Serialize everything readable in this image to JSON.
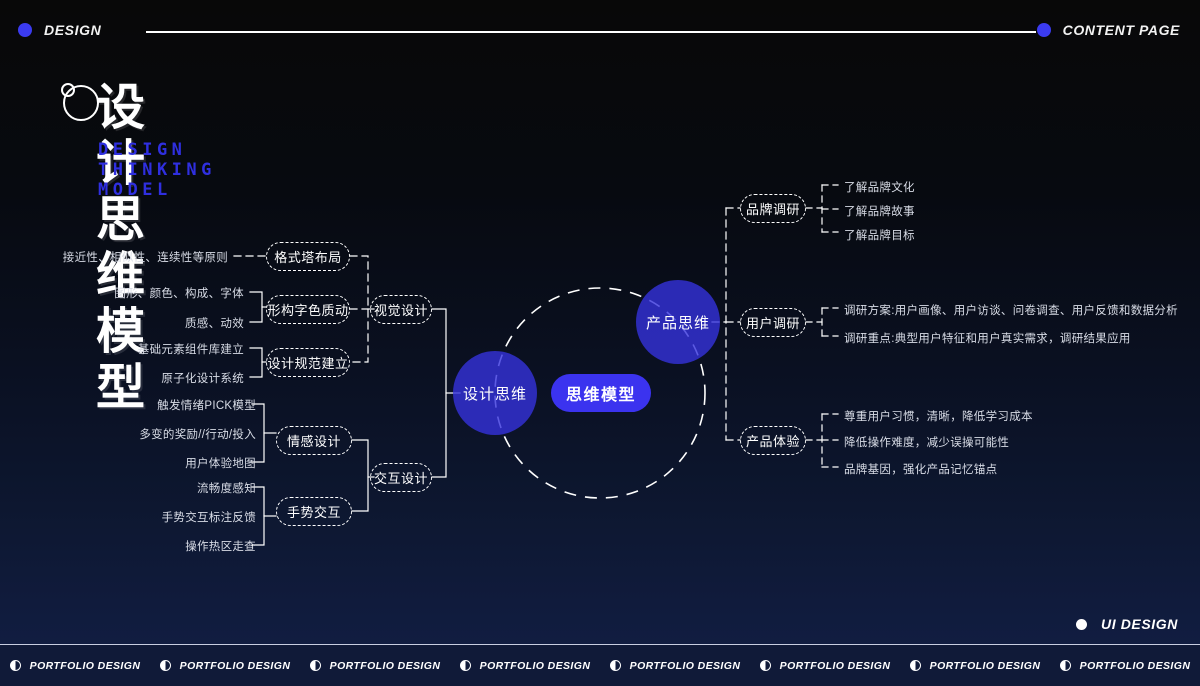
{
  "header": {
    "left_label": "DESIGN",
    "right_label": "CONTENT PAGE",
    "left_dot_icon": "blue-dot-icon",
    "right_dot_icon": "blue-dot-icon",
    "accent_color": "#3b3bf0"
  },
  "title": {
    "cn": "设计思维模型",
    "en": "DESIGN THINKING MODEL",
    "en_color": "#2f2fe0",
    "decor_icon": "ring-with-small-circle-icon"
  },
  "center": {
    "core_label": "思维模型",
    "core_color": "#3b33ef",
    "left_circle_label": "设计思维",
    "right_circle_label": "产品思维",
    "circle_color": "#3532dc",
    "ring_style": "dashed"
  },
  "left_branch": {
    "nodes": [
      {
        "label": "视觉设计",
        "children": [
          {
            "label": "格式塔布局",
            "leaves": [
              "接近性、相似性、连续性等原则"
            ]
          },
          {
            "label": "形构字色质动",
            "leaves": [
              "图形、颜色、构成、字体",
              "质感、动效"
            ]
          },
          {
            "label": "设计规范建立",
            "leaves": [
              "基础元素组件库建立",
              "原子化设计系统"
            ]
          }
        ]
      },
      {
        "label": "交互设计",
        "children": [
          {
            "label": "情感设计",
            "leaves": [
              "触发情绪PICK模型",
              "多变的奖励//行动/投入",
              "用户体验地图"
            ]
          },
          {
            "label": "手势交互",
            "leaves": [
              "流畅度感知",
              "手势交互标注反馈",
              "操作热区走查"
            ]
          }
        ]
      }
    ]
  },
  "right_branch": {
    "nodes": [
      {
        "label": "品牌调研",
        "leaves": [
          "了解品牌文化",
          "了解品牌故事",
          "了解品牌目标"
        ]
      },
      {
        "label": "用户调研",
        "leaves": [
          "调研方案:用户画像、用户访谈、问卷调查、用户反馈和数据分析",
          "调研重点:典型用户特征和用户真实需求，调研结果应用"
        ]
      },
      {
        "label": "产品体验",
        "leaves": [
          "尊重用户习惯，清晰，降低学习成本",
          "降低操作难度，减少误操可能性",
          "品牌基因，强化产品记忆锚点"
        ]
      }
    ]
  },
  "bottom_right": {
    "label": "UI DESIGN",
    "dot_icon": "white-dot-icon"
  },
  "footer": {
    "icon": "half-filled-circle-icon",
    "items": [
      "PORTFOLIO DESIGN",
      "PORTFOLIO DESIGN",
      "PORTFOLIO DESIGN",
      "PORTFOLIO DESIGN",
      "PORTFOLIO DESIGN",
      "PORTFOLIO DESIGN",
      "PORTFOLIO DESIGN",
      "PORTFOLIO DESIGN"
    ]
  }
}
